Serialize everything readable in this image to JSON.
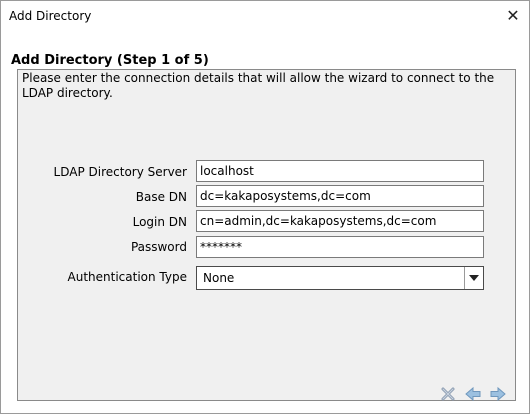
{
  "window": {
    "title": "Add Directory"
  },
  "wizard": {
    "step_title": "Add Directory (Step 1 of 5)",
    "description": "Please enter the connection details that will allow the wizard to connect to the LDAP directory."
  },
  "form": {
    "server": {
      "label": "LDAP Directory Server",
      "value": "localhost"
    },
    "base_dn": {
      "label": "Base DN",
      "value": "dc=kakaposystems,dc=com"
    },
    "login_dn": {
      "label": "Login DN",
      "value": "cn=admin,dc=kakaposystems,dc=com"
    },
    "password": {
      "label": "Password",
      "value": "*******"
    },
    "auth_type": {
      "label": "Authentication Type",
      "value": "None"
    }
  },
  "icons": {
    "close": "close-icon",
    "cancel": "cancel-icon",
    "back": "arrow-left-icon",
    "next": "arrow-right-icon"
  }
}
